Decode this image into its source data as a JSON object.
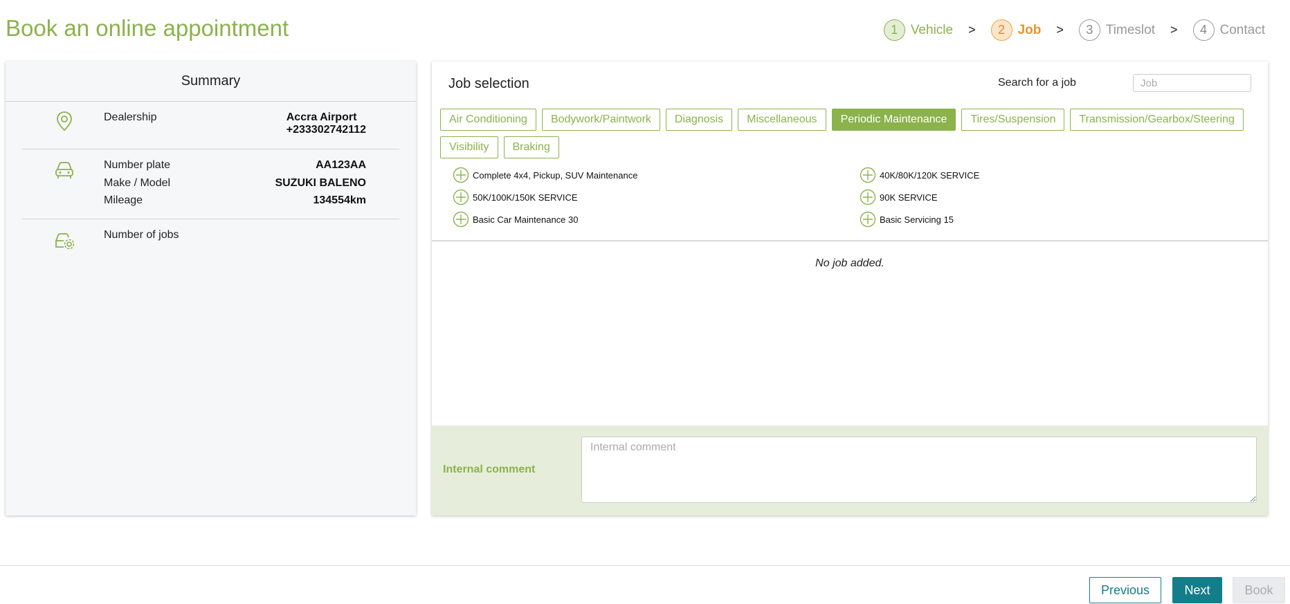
{
  "page": {
    "title": "Book an online appointment"
  },
  "stepper": {
    "steps": [
      {
        "num": "1",
        "label": "Vehicle"
      },
      {
        "num": "2",
        "label": "Job"
      },
      {
        "num": "3",
        "label": "Timeslot"
      },
      {
        "num": "4",
        "label": "Contact"
      }
    ],
    "separator": ">"
  },
  "summary": {
    "title": "Summary",
    "dealership": {
      "icon": "location-pin-icon",
      "label": "Dealership",
      "name": "Accra Airport",
      "phone": "+233302742112"
    },
    "vehicle": {
      "icon": "car-icon",
      "rows": [
        {
          "label": "Number plate",
          "value": "AA123AA"
        },
        {
          "label": "Make / Model",
          "value": "SUZUKI BALENO"
        },
        {
          "label": "Mileage",
          "value": "134554km"
        }
      ]
    },
    "jobs": {
      "icon": "car-service-icon",
      "label": "Number of jobs"
    }
  },
  "job_selection": {
    "title": "Job selection",
    "search_label": "Search for a job",
    "search_placeholder": "Job",
    "categories": [
      "Air Conditioning",
      "Bodywork/Paintwork",
      "Diagnosis",
      "Miscellaneous",
      "Periodic Maintenance",
      "Tires/Suspension",
      "Transmission/Gearbox/Steering",
      "Visibility",
      "Braking"
    ],
    "selected_category": "Periodic Maintenance",
    "jobs": [
      "Complete 4x4, Pickup, SUV Maintenance",
      "40K/80K/120K SERVICE",
      "50K/100K/150K SERVICE",
      "90K SERVICE",
      "Basic Car Maintenance 30",
      "Basic Servicing 15"
    ],
    "empty_message": "No job added.",
    "comment_label": "Internal comment",
    "comment_placeholder": "Internal comment"
  },
  "footer": {
    "previous": "Previous",
    "next": "Next",
    "book": "Book"
  },
  "colors": {
    "brand_green": "#8bb24b",
    "active_orange": "#e6962f",
    "teal": "#137d8a"
  }
}
